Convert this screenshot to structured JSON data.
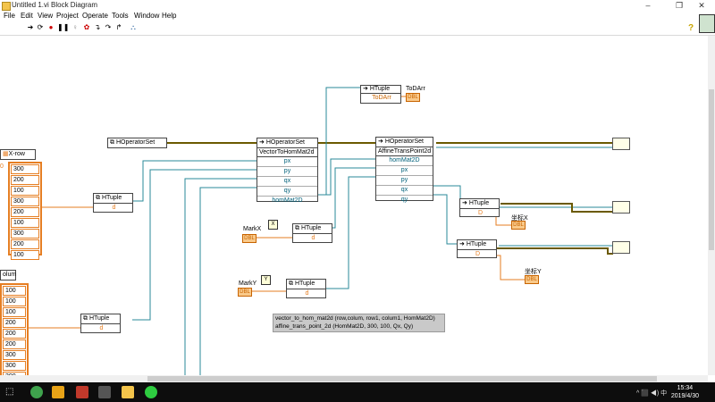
{
  "window": {
    "title": "Untitled 1.vi Block Diagram",
    "controls": [
      "–",
      "❐",
      "✕"
    ]
  },
  "menu": [
    "File",
    "Edit",
    "View",
    "Project",
    "Operate",
    "Tools",
    "Window",
    "Help"
  ],
  "toolbar": {
    "icons": [
      "run-arrow-icon",
      "run-continuous-icon",
      "abort-icon",
      "pause-icon",
      "highlight-bulb-icon",
      "retain-wire-icon",
      "step-into-icon",
      "step-over-icon",
      "step-out-icon",
      "clean-up-icon"
    ]
  },
  "help_icon": "?",
  "arrays": {
    "xrow": {
      "label": "X-row",
      "values": [
        "300",
        "200",
        "100",
        "300",
        "200",
        "100",
        "300",
        "200",
        "100"
      ]
    },
    "column": {
      "label": "olum",
      "values": [
        "100",
        "100",
        "100",
        "200",
        "200",
        "200",
        "300",
        "300",
        "300"
      ]
    }
  },
  "nodes": {
    "htuple1": {
      "title": "HTuple",
      "sub": "d"
    },
    "htuple2": {
      "title": "HTuple",
      "sub": "d"
    },
    "htuple_markx": {
      "title": "HTuple",
      "sub": "d"
    },
    "htuple_marky": {
      "title": "HTuple",
      "sub": "d"
    },
    "htuple_qx": {
      "title": "HTuple",
      "sub": "D"
    },
    "htuple_qy": {
      "title": "HTuple",
      "sub": "D"
    },
    "htuple_todarr": {
      "title": "HTuple",
      "method": "ToDArr"
    },
    "hoperator_const": {
      "title": "HOperatorSet"
    },
    "vector_to_hom": {
      "title": "HOperatorSet",
      "method": "VectorToHomMat2d",
      "params": [
        "px",
        "py",
        "qx",
        "qy",
        "homMat2D"
      ]
    },
    "affine_trans": {
      "title": "HOperatorSet",
      "method": "AffineTransPoint2d",
      "params": [
        "homMat2D",
        "px",
        "py",
        "qx",
        "qy"
      ]
    }
  },
  "labels": {
    "todarr": "ToDArr",
    "markx": "MarkX",
    "marky": "MarkY",
    "x_box": "X",
    "y_box": "Y",
    "coord_x": "坐标X",
    "coord_y": "坐标Y",
    "dbl": "DBL"
  },
  "comment": {
    "line1": "vector_to_hom_mat2d (row,colum, row1, colum1, HomMat2D)",
    "line2": "affine_trans_point_2d (HomMat2D, 300, 100, Qx, Qy)"
  },
  "taskbar": {
    "time": "15:34",
    "date": "2019/4/30",
    "tray": "^ ⬛ ◀) 中"
  },
  "colors": {
    "wire_blue": "#2a8a98",
    "wire_orange": "#e67e22",
    "wire_olive": "#6b5a00"
  }
}
